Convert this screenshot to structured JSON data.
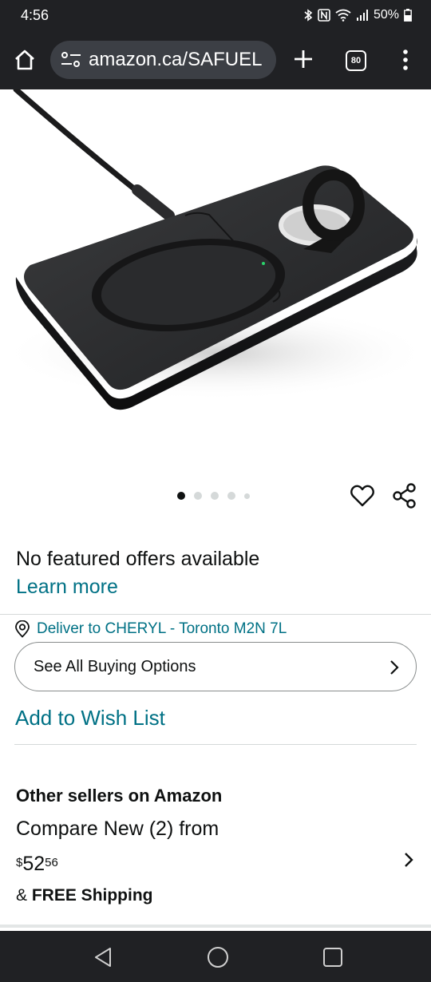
{
  "status_bar": {
    "time": "4:56",
    "battery": "50%",
    "icons": [
      "bluetooth-icon",
      "nfc-icon",
      "wifi-icon",
      "signal-icon",
      "battery-icon"
    ]
  },
  "browser": {
    "url": "amazon.ca/SAFUEL",
    "tab_count": "80"
  },
  "gallery": {
    "image_count": 5,
    "active_index": 0
  },
  "offers": {
    "no_offers": "No featured offers available",
    "learn_more": "Learn more"
  },
  "delivery": {
    "text": "Deliver to CHERYL - Toronto M2N 7L"
  },
  "buttons": {
    "see_all": "See All Buying Options",
    "wish_list": "Add to Wish List"
  },
  "other_sellers": {
    "title": "Other sellers on Amazon",
    "compare": "Compare New (2) from",
    "price_symbol": "$",
    "price_whole": "52",
    "price_fraction": "56",
    "shipping_prefix": "& ",
    "shipping_bold": "FREE Shipping"
  },
  "colors": {
    "link": "#007185",
    "chrome_dark": "#202124",
    "text": "#0f1111"
  }
}
